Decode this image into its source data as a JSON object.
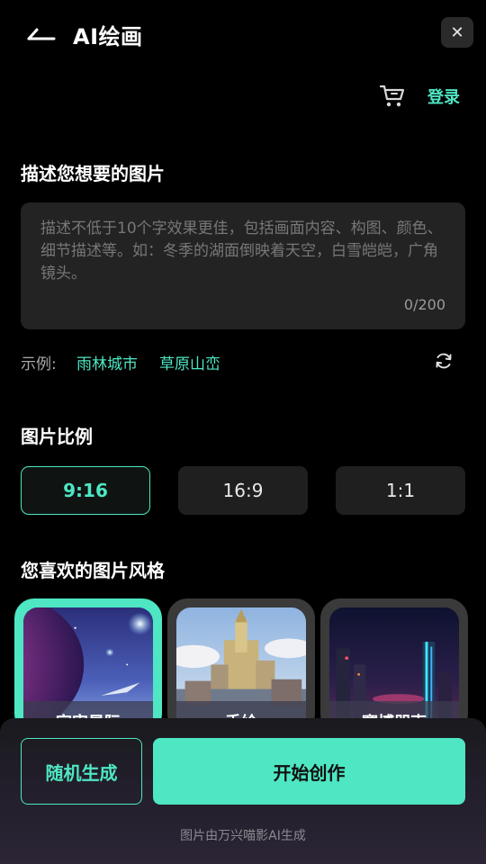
{
  "header": {
    "title": "AI绘画",
    "back_icon": "back-arrow-icon",
    "close_label": "✕",
    "cart_icon": "cart-icon",
    "login_label": "登录"
  },
  "prompt": {
    "heading": "描述您想要的图片",
    "placeholder": "描述不低于10个字效果更佳，包括画面内容、构图、颜色、细节描述等。如：冬季的湖面倒映着天空，白雪皑皑，广角镜头。",
    "value": "",
    "char_count": "0/200"
  },
  "examples": {
    "label": "示例:",
    "items": [
      "雨林城市",
      "草原山峦"
    ],
    "refresh_icon": "refresh-icon"
  },
  "ratio": {
    "heading": "图片比例",
    "options": [
      "9:16",
      "16:9",
      "1:1"
    ],
    "selected": "9:16"
  },
  "styles": {
    "heading": "您喜欢的图片风格",
    "items": [
      {
        "label": "宇宙星际",
        "selected": true
      },
      {
        "label": "手绘",
        "selected": false
      },
      {
        "label": "赛博朋克",
        "selected": false
      }
    ]
  },
  "actions": {
    "random_label": "随机生成",
    "start_label": "开始创作"
  },
  "footer": {
    "note": "图片由万兴喵影AI生成"
  },
  "colors": {
    "accent": "#4ee6c3",
    "background": "#000000",
    "surface": "#232323"
  }
}
